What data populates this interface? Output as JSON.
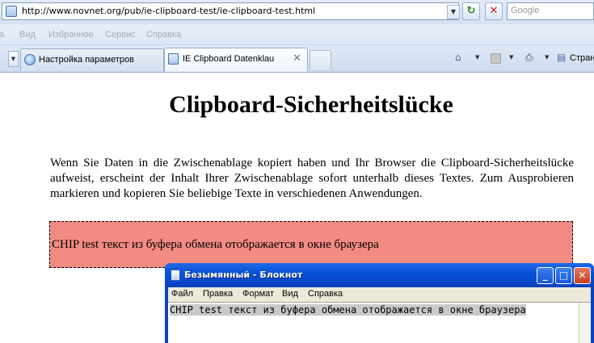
{
  "browser": {
    "address": {
      "url": "http://www.novnet.org/pub/ie-clipboard-test/ie-clipboard-test.html"
    },
    "search": {
      "placeholder": "Google"
    },
    "menu": [
      "Вид",
      "Избранное",
      "Сервис",
      "Справка"
    ],
    "menu_partial": "а",
    "tabs": [
      {
        "label": "Настройка параметров",
        "active": false
      },
      {
        "label": "IE Clipboard Datenklau",
        "active": true
      }
    ],
    "command_bar": {
      "page_label": "Стран"
    }
  },
  "page": {
    "title": "Clipboard-Sicherheitslücke",
    "paragraph": "Wenn Sie Daten in die Zwischenablage kopiert haben und Ihr Browser die Clipboard-Sicherheitslücke aufweist, erscheint der Inhalt Ihrer Zwischenablage sofort unterhalb dieses Textes. Zum Ausprobieren markieren und kopieren Sie beliebige Texte in verschiedenen Anwendungen.",
    "clipboard_text": "CHIP test текст из буфера обмена отображается в окне браузера",
    "clipboard_box_color": "#f28b82"
  },
  "notepad": {
    "title": "Безымянный - Блокнот",
    "menu": [
      {
        "label": "Файл"
      },
      {
        "label": "Правка"
      },
      {
        "label": "Формат"
      },
      {
        "label": "Вид"
      },
      {
        "label": "Справка"
      }
    ],
    "text": "CHIP test текст из буфера обмена отображается в окне браузера"
  },
  "colors": {
    "xp_title_blue": "#0853d8",
    "close_red": "#c6401e"
  }
}
